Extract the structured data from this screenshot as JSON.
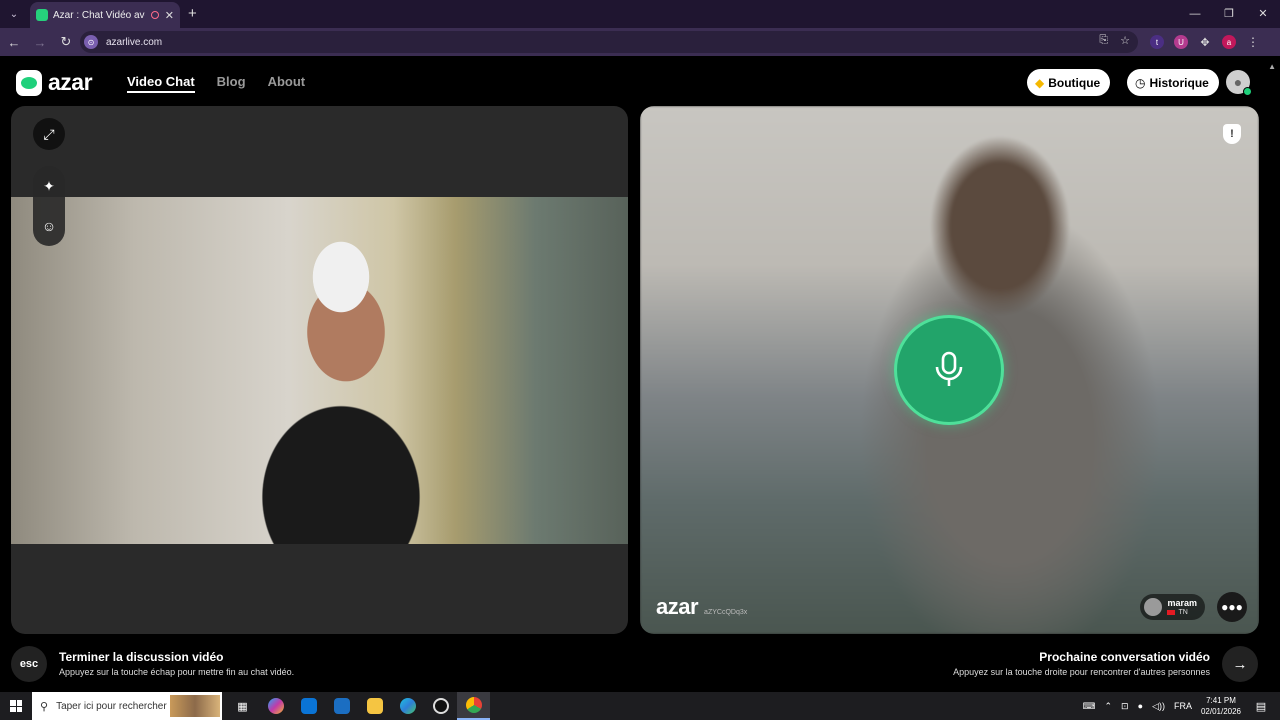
{
  "browser": {
    "tab_title": "Azar : Chat Vidéo avec de n",
    "tab_close": "✕",
    "new_tab": "+",
    "url": "azarlive.com",
    "ext_letters": [
      "t",
      "U",
      "a"
    ]
  },
  "header": {
    "logo_text": "azar",
    "nav": [
      {
        "label": "Video Chat",
        "active": true
      },
      {
        "label": "Blog"
      },
      {
        "label": "About"
      }
    ],
    "boutique_label": "Boutique",
    "historique_label": "Historique"
  },
  "peer": {
    "watermark_logo": "azar",
    "watermark_id": "aZYCcQDq3x",
    "name": "maram",
    "country": "TN"
  },
  "actions": {
    "esc_key": "esc",
    "end_title": "Terminer la discussion vidéo",
    "end_sub": "Appuyez sur la touche échap pour mettre fin au chat vidéo.",
    "next_title": "Prochaine conversation vidéo",
    "next_sub": "Appuyez sur la touche droite pour rencontrer d'autres personnes"
  },
  "taskbar": {
    "search_placeholder": "Taper ici pour rechercher",
    "language": "FRA",
    "time": "7:41 PM",
    "date": "02/01/2026"
  },
  "colors": {
    "accent_green": "#22a46a",
    "browser_frame": "#3b2d52"
  }
}
